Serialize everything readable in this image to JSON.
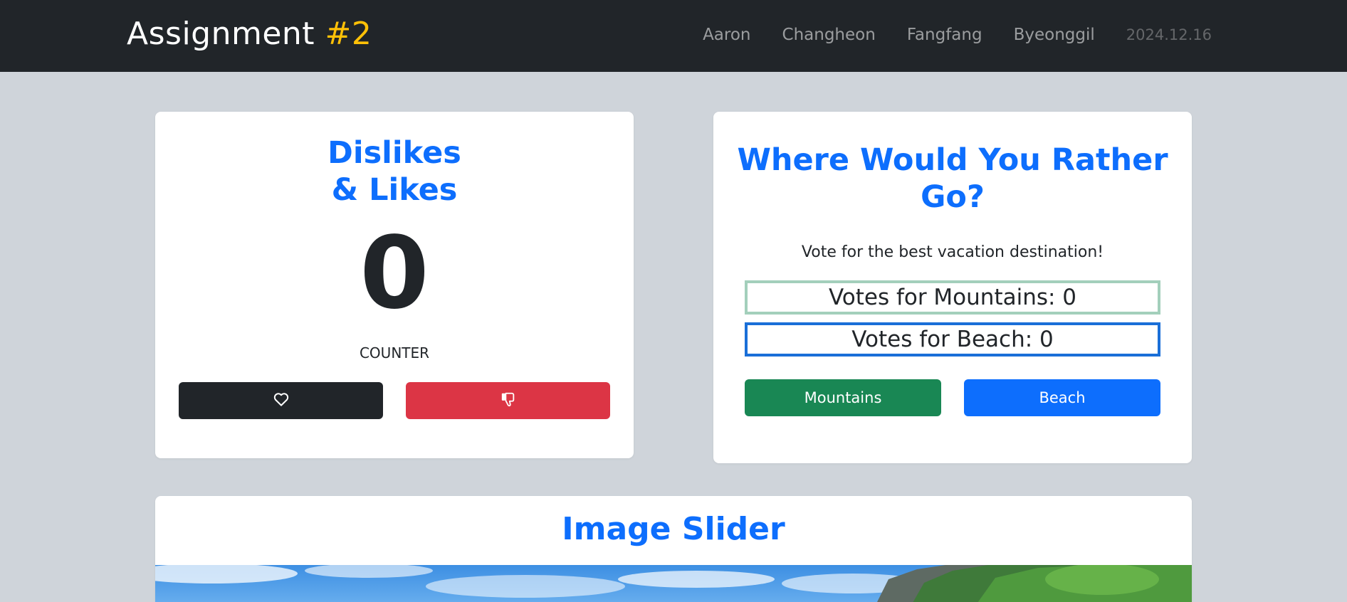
{
  "navbar": {
    "brand_text": "Assignment ",
    "brand_accent": "#2",
    "links": [
      "Aaron",
      "Changheon",
      "Fangfang",
      "Byeonggil"
    ],
    "date": "2024.12.16"
  },
  "counter_card": {
    "title_line1": "Dislikes",
    "title_line2": "& Likes",
    "value": "0",
    "label": "COUNTER",
    "like_icon": "heart-icon",
    "dislike_icon": "thumbs-down-icon"
  },
  "vote_card": {
    "title": "Where Would You Rather Go?",
    "subtitle": "Vote for the best vacation destination!",
    "mountains_votes": "Votes for Mountains: 0",
    "beach_votes": "Votes for Beach: 0",
    "mountains_button": "Mountains",
    "beach_button": "Beach"
  },
  "slider_card": {
    "title": "Image Slider"
  },
  "colors": {
    "navbar_bg": "#212529",
    "accent_yellow": "#ffc107",
    "title_blue": "#0d6efd",
    "page_bg": "#cfd4da",
    "like_button": "#212529",
    "dislike_button": "#dc3545",
    "mountains_button": "#198754",
    "beach_button": "#0d6efd"
  }
}
